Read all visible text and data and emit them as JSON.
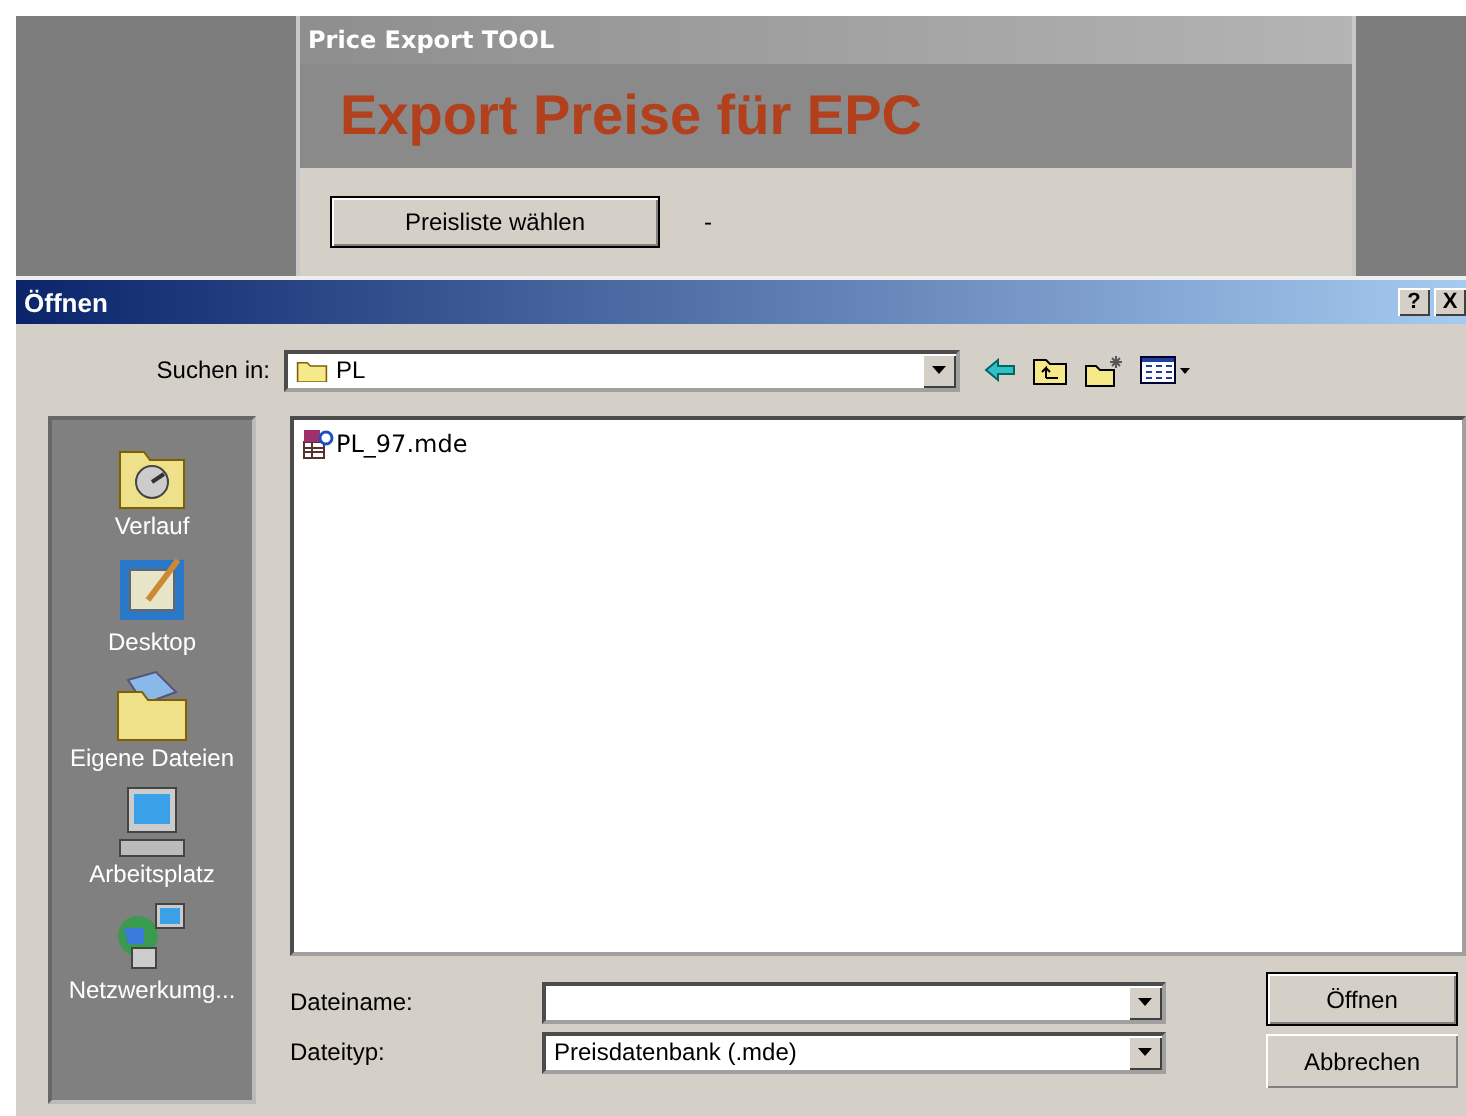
{
  "app": {
    "title": "Price Export TOOL",
    "heading": "Export Preise für EPC",
    "button": "Preisliste wählen",
    "status": "-"
  },
  "dialog": {
    "title": "Öffnen",
    "title_buttons": [
      "?",
      "X"
    ],
    "look_in": {
      "label": "Suchen in:",
      "value": "PL"
    },
    "places": [
      {
        "kind": "history",
        "label": "Verlauf"
      },
      {
        "kind": "desktop",
        "label": "Desktop"
      },
      {
        "kind": "documents",
        "label": "Eigene Dateien"
      },
      {
        "kind": "computer",
        "label": "Arbeitsplatz"
      },
      {
        "kind": "network",
        "label": "Netzwerkumg..."
      }
    ],
    "files": [
      {
        "name": "PL_97.mde",
        "selected": false
      }
    ],
    "filename": {
      "label": "Dateiname:"
    },
    "filetype": {
      "label": "Dateityp:",
      "value": "Preisdatenbank (.mde)"
    },
    "buttons": [
      "Öffnen",
      "Abbrechen"
    ]
  }
}
